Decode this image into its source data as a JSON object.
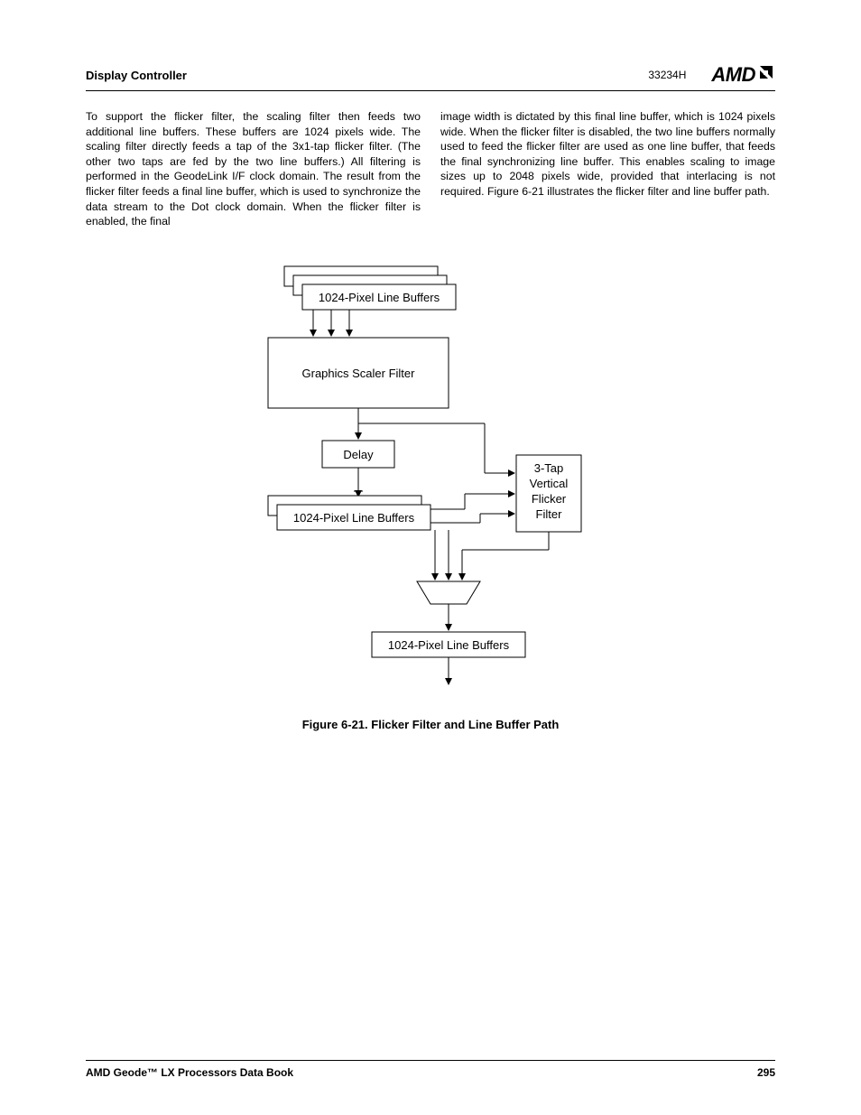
{
  "header": {
    "section_title": "Display Controller",
    "doc_id": "33234H",
    "logo_text": "AMD"
  },
  "body": {
    "col1": "To support the flicker filter, the scaling filter then feeds two additional line buffers. These buffers are 1024 pixels wide. The scaling filter directly feeds a tap of the 3x1-tap flicker filter. (The other two taps are fed by the two line buffers.) All filtering is performed in the GeodeLink I/F clock domain. The result from the flicker filter feeds a final line buffer, which is used to synchronize the data stream to the Dot clock domain. When the flicker filter is enabled, the final",
    "col2": "image width is dictated by this final line buffer, which is 1024 pixels wide. When the flicker filter is disabled, the two line buffers normally used to feed the flicker filter are used as one line buffer, that feeds the final synchronizing line buffer. This enables scaling to image sizes up to 2048 pixels wide, provided that interlacing is not required. Figure 6-21 illustrates the flicker filter and line buffer path."
  },
  "diagram": {
    "box1": "1024-Pixel Line Buffers",
    "box2": "Graphics Scaler Filter",
    "box3": "Delay",
    "box4": "1024-Pixel Line Buffers",
    "box5_l1": "3-Tap",
    "box5_l2": "Vertical",
    "box5_l3": "Flicker",
    "box5_l4": "Filter",
    "box6": "1024-Pixel Line Buffers"
  },
  "figure_caption": "Figure 6-21.  Flicker Filter and Line Buffer Path",
  "footer": {
    "book_title": "AMD Geode™ LX Processors Data Book",
    "page_number": "295"
  }
}
